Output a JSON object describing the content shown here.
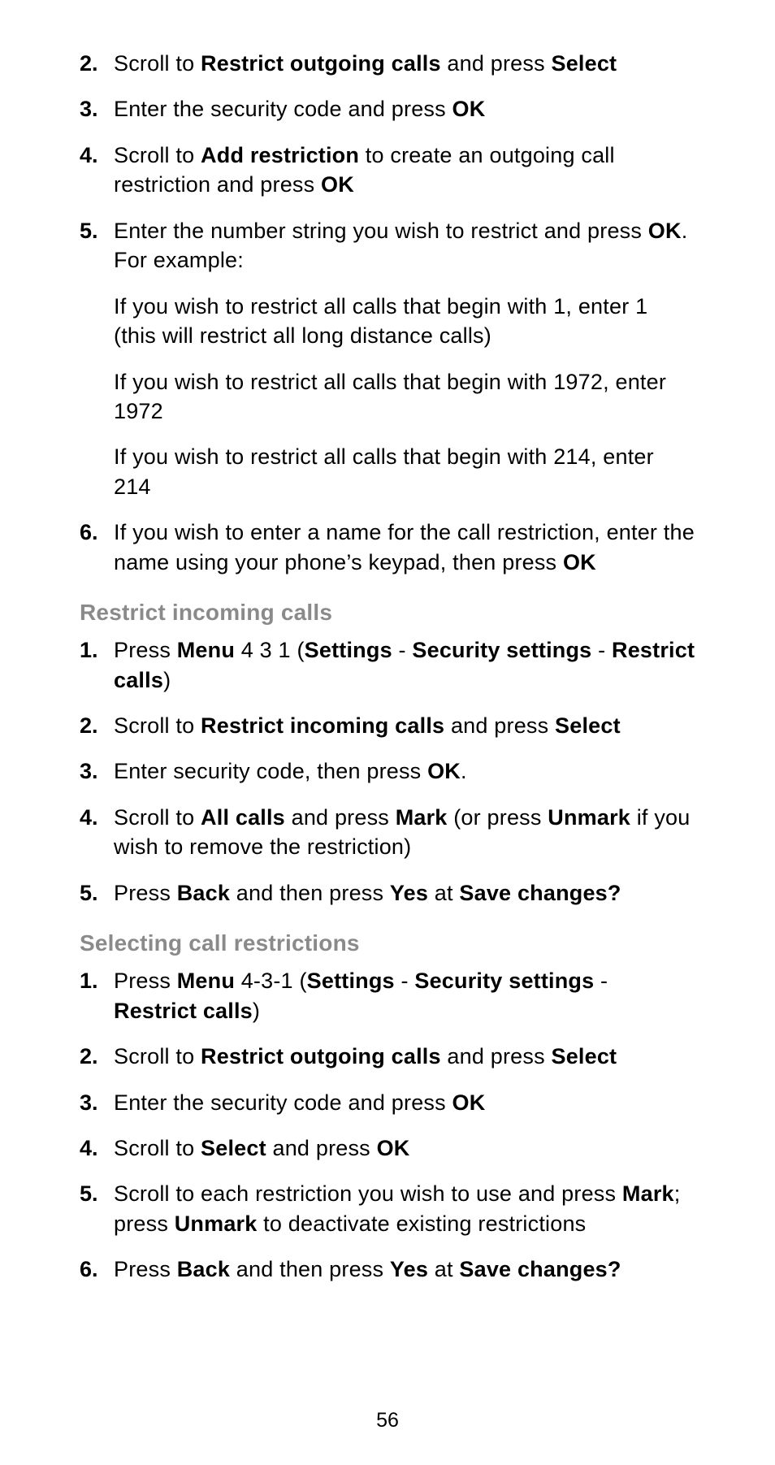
{
  "page_number": "56",
  "sections": [
    {
      "heading": null,
      "start_num": 2,
      "items": [
        {
          "paragraphs": [
            {
              "runs": [
                {
                  "t": "Scroll to "
                },
                {
                  "t": "Restrict outgoing calls",
                  "b": true
                },
                {
                  "t": " and press "
                },
                {
                  "t": "Select",
                  "b": true
                }
              ]
            }
          ]
        },
        {
          "paragraphs": [
            {
              "runs": [
                {
                  "t": "Enter the security code and press "
                },
                {
                  "t": "OK",
                  "b": true
                }
              ]
            }
          ]
        },
        {
          "paragraphs": [
            {
              "runs": [
                {
                  "t": "Scroll to "
                },
                {
                  "t": "Add restriction",
                  "b": true
                },
                {
                  "t": " to create an outgoing call restriction and press "
                },
                {
                  "t": "OK",
                  "b": true
                }
              ]
            }
          ]
        },
        {
          "paragraphs": [
            {
              "runs": [
                {
                  "t": "Enter the number string you wish to restrict and press "
                },
                {
                  "t": "OK",
                  "b": true
                },
                {
                  "t": ". For example:"
                }
              ]
            },
            {
              "runs": [
                {
                  "t": "If you wish to restrict all calls that begin with 1, enter 1 (this will restrict all long distance calls)"
                }
              ]
            },
            {
              "runs": [
                {
                  "t": "If you wish to restrict all calls that begin with 1972, enter 1972"
                }
              ]
            },
            {
              "runs": [
                {
                  "t": "If you wish to restrict all calls that begin with 214, enter 214"
                }
              ]
            }
          ]
        },
        {
          "paragraphs": [
            {
              "runs": [
                {
                  "t": "If you wish to enter a name for the call restriction, enter the name using your phone’s keypad, then press "
                },
                {
                  "t": "OK",
                  "b": true
                }
              ]
            }
          ]
        }
      ]
    },
    {
      "heading": "Restrict incoming calls",
      "start_num": 1,
      "items": [
        {
          "paragraphs": [
            {
              "runs": [
                {
                  "t": "Press "
                },
                {
                  "t": "Menu",
                  "b": true
                },
                {
                  "t": " 4 3 1 ("
                },
                {
                  "t": "Settings",
                  "b": true
                },
                {
                  "t": " - "
                },
                {
                  "t": "Security settings",
                  "b": true
                },
                {
                  "t": " - "
                },
                {
                  "t": "Restrict calls",
                  "b": true
                },
                {
                  "t": ")"
                }
              ]
            }
          ]
        },
        {
          "paragraphs": [
            {
              "runs": [
                {
                  "t": "Scroll to "
                },
                {
                  "t": "Restrict incoming calls",
                  "b": true
                },
                {
                  "t": " and press "
                },
                {
                  "t": "Select",
                  "b": true
                }
              ]
            }
          ]
        },
        {
          "paragraphs": [
            {
              "runs": [
                {
                  "t": "Enter security code, then press "
                },
                {
                  "t": "OK",
                  "b": true
                },
                {
                  "t": "."
                }
              ]
            }
          ]
        },
        {
          "paragraphs": [
            {
              "runs": [
                {
                  "t": "Scroll to "
                },
                {
                  "t": "All calls",
                  "b": true
                },
                {
                  "t": " and press "
                },
                {
                  "t": "Mark",
                  "b": true
                },
                {
                  "t": " (or press "
                },
                {
                  "t": "Unmark",
                  "b": true
                },
                {
                  "t": " if you wish to remove the restriction)"
                }
              ]
            }
          ]
        },
        {
          "paragraphs": [
            {
              "runs": [
                {
                  "t": "Press "
                },
                {
                  "t": "Back",
                  "b": true
                },
                {
                  "t": " and then press "
                },
                {
                  "t": "Yes",
                  "b": true
                },
                {
                  "t": " at "
                },
                {
                  "t": "Save changes?",
                  "b": true
                }
              ]
            }
          ]
        }
      ]
    },
    {
      "heading": "Selecting call restrictions",
      "start_num": 1,
      "items": [
        {
          "paragraphs": [
            {
              "runs": [
                {
                  "t": "Press "
                },
                {
                  "t": "Menu",
                  "b": true
                },
                {
                  "t": " 4-3-1 ("
                },
                {
                  "t": "Settings",
                  "b": true
                },
                {
                  "t": " - "
                },
                {
                  "t": "Security settings",
                  "b": true
                },
                {
                  "t": " - "
                },
                {
                  "t": "Restrict calls",
                  "b": true
                },
                {
                  "t": ")"
                }
              ]
            }
          ]
        },
        {
          "paragraphs": [
            {
              "runs": [
                {
                  "t": "Scroll to "
                },
                {
                  "t": "Restrict outgoing calls",
                  "b": true
                },
                {
                  "t": " and press "
                },
                {
                  "t": "Select",
                  "b": true
                }
              ]
            }
          ]
        },
        {
          "paragraphs": [
            {
              "runs": [
                {
                  "t": "Enter the security code and press "
                },
                {
                  "t": "OK",
                  "b": true
                }
              ]
            }
          ]
        },
        {
          "paragraphs": [
            {
              "runs": [
                {
                  "t": "Scroll to "
                },
                {
                  "t": "Select",
                  "b": true
                },
                {
                  "t": " and press "
                },
                {
                  "t": "OK",
                  "b": true
                }
              ]
            }
          ]
        },
        {
          "paragraphs": [
            {
              "runs": [
                {
                  "t": "Scroll to each restriction you wish to use and press "
                },
                {
                  "t": "Mark",
                  "b": true
                },
                {
                  "t": "; press "
                },
                {
                  "t": "Unmark",
                  "b": true
                },
                {
                  "t": " to deactivate existing restrictions"
                }
              ]
            }
          ]
        },
        {
          "paragraphs": [
            {
              "runs": [
                {
                  "t": "Press "
                },
                {
                  "t": "Back",
                  "b": true
                },
                {
                  "t": " and then press "
                },
                {
                  "t": "Yes",
                  "b": true
                },
                {
                  "t": " at "
                },
                {
                  "t": "Save changes?",
                  "b": true
                }
              ]
            }
          ]
        }
      ]
    }
  ]
}
